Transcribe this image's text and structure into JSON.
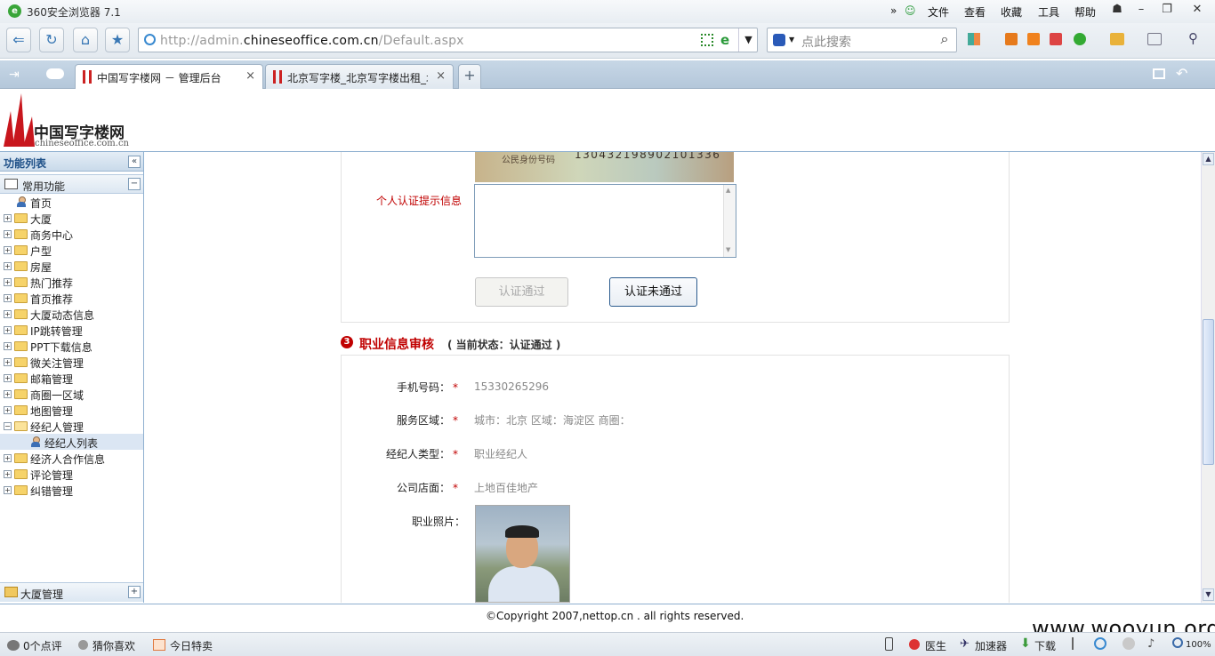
{
  "browser": {
    "title": "360安全浏览器 7.1",
    "menus": [
      "文件",
      "查看",
      "收藏",
      "工具",
      "帮助"
    ],
    "url_prefix": "http://admin.",
    "url_domain": "chineseoffice.com.cn",
    "url_path": "/Default.aspx",
    "search_placeholder": "点此搜索",
    "tabs": [
      {
        "label": "中国写字楼网 － 管理后台",
        "close": "×"
      },
      {
        "label": "北京写字楼_北京写字楼出租_北",
        "close": "×"
      }
    ],
    "new_tab": "+"
  },
  "site": {
    "logo_text": "中国写字楼网",
    "logo_sub": "chineseoffice.com.cn"
  },
  "sidebar": {
    "title": "功能列表",
    "group": "常用功能",
    "items": [
      {
        "label": "首页"
      },
      {
        "label": "大厦"
      },
      {
        "label": "商务中心"
      },
      {
        "label": "户型"
      },
      {
        "label": "房屋"
      },
      {
        "label": "热门推荐"
      },
      {
        "label": "首页推荐"
      },
      {
        "label": "大厦动态信息"
      },
      {
        "label": "IP跳转管理"
      },
      {
        "label": "PPT下载信息"
      },
      {
        "label": "微关注管理"
      },
      {
        "label": "邮箱管理"
      },
      {
        "label": "商圈一区域"
      },
      {
        "label": "地图管理"
      },
      {
        "label": "经纪人管理"
      },
      {
        "label": "经纪人列表"
      },
      {
        "label": "经济人合作信息"
      },
      {
        "label": "评论管理"
      },
      {
        "label": "纠错管理"
      }
    ],
    "footer_group": "大厦管理"
  },
  "main": {
    "id_card_caption": "公民身份号码",
    "id_card_number": "130432198902101336",
    "personal_hint_label": "个人认证提示信息",
    "btn_pass": "认证通过",
    "btn_fail": "认证未通过",
    "section3_num": "3",
    "section3_title": "职业信息审核",
    "section3_status": "( 当前状态：认证通过 )",
    "fields": [
      {
        "label": "手机号码：",
        "value": "15330265296"
      },
      {
        "label": "服务区域：",
        "value": "城市：北京 区域：海淀区 商圈："
      },
      {
        "label": "经纪人类型：",
        "value": "职业经纪人"
      },
      {
        "label": "公司店面：",
        "value": "上地百佳地产"
      }
    ],
    "photo_label": "职业照片：",
    "required_mark": "*"
  },
  "footer": {
    "copyright": "©Copyright 2007,nettop.cn . all rights reserved.",
    "watermark": "www.wooyun.org"
  },
  "statusbar": {
    "left": [
      "0个点评",
      "猜你喜欢",
      "今日特卖"
    ],
    "right": [
      "医生",
      "加速器",
      "下载"
    ],
    "zoom": "100%"
  }
}
